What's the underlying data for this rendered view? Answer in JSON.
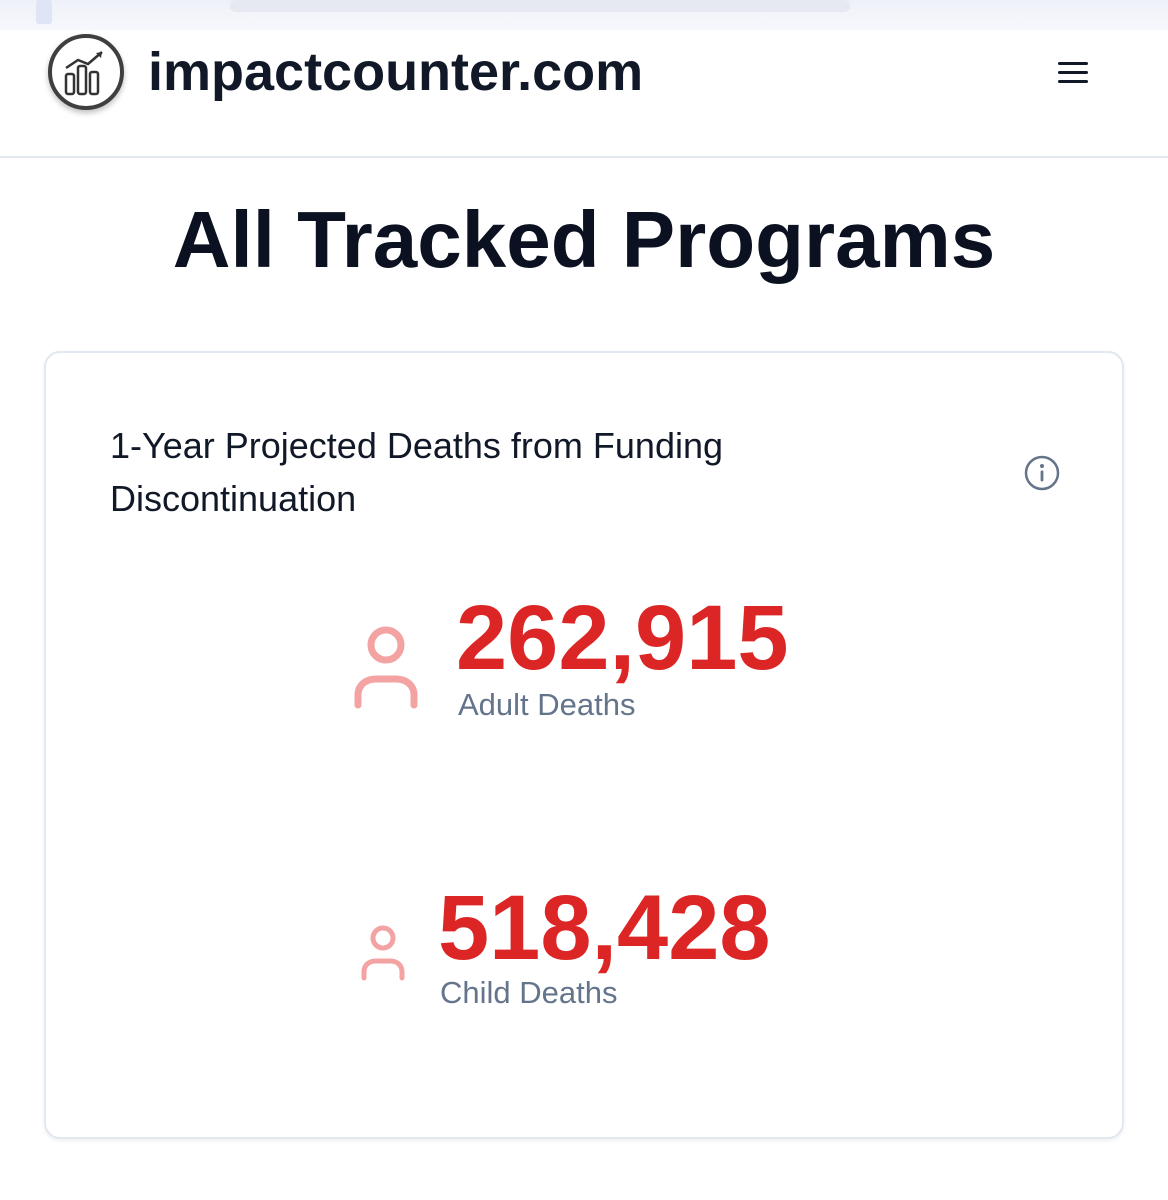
{
  "header": {
    "site_name": "impactcounter.com",
    "logo_icon": "chart-logo-icon",
    "menu_icon": "hamburger-menu-icon"
  },
  "page": {
    "title": "All Tracked Programs"
  },
  "card": {
    "title": "1-Year Projected Deaths from Funding Discontinuation",
    "info_icon": "info-icon",
    "stats": [
      {
        "icon": "person-icon",
        "value": "262,915",
        "label": "Adult Deaths"
      },
      {
        "icon": "person-icon",
        "value": "518,428",
        "label": "Child Deaths"
      }
    ]
  },
  "colors": {
    "accent_red": "#dc2626",
    "icon_pink": "#f4a3a3",
    "muted_text": "#64748b",
    "border": "#e2e8f0"
  }
}
